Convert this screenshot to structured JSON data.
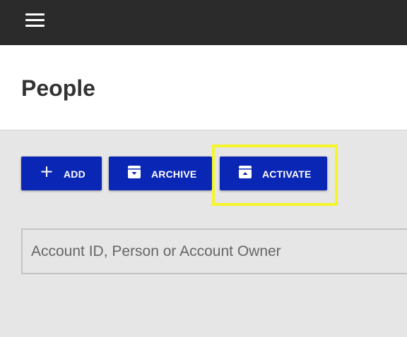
{
  "header": {
    "menu_icon": "hamburger-menu-icon"
  },
  "page": {
    "title": "People"
  },
  "toolbar": {
    "add": {
      "label": "ADD",
      "icon": "plus-icon"
    },
    "archive": {
      "label": "ARCHIVE",
      "icon": "archive-down-icon"
    },
    "activate": {
      "label": "ACTIVATE",
      "icon": "archive-up-icon",
      "highlighted": true
    }
  },
  "search": {
    "placeholder": "Account ID, Person or Account Owner",
    "value": ""
  },
  "colors": {
    "topbar": "#2b2b2b",
    "button": "#0a26b5",
    "highlight": "#f5f52a",
    "background": "#e6e6e6"
  }
}
